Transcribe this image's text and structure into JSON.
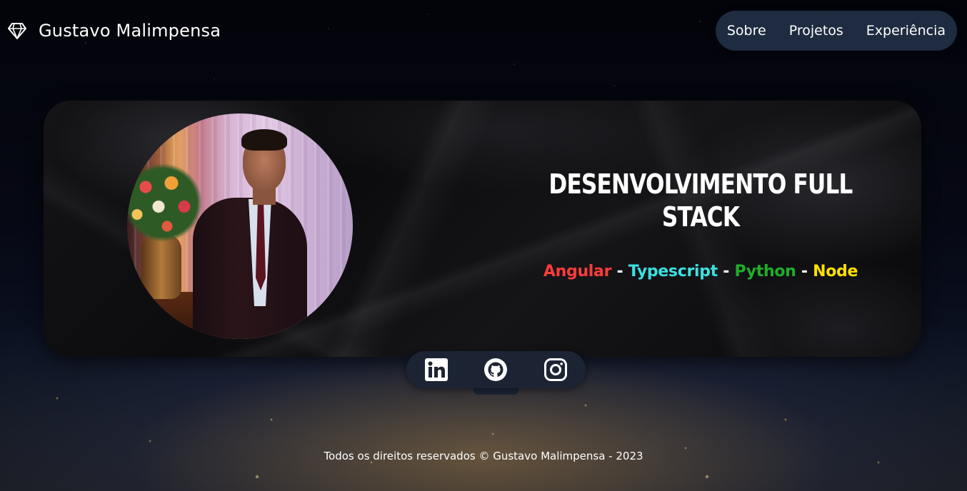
{
  "header": {
    "brand_icon": "diamond-icon",
    "brand_name": "Gustavo Malimpensa"
  },
  "nav": {
    "items": [
      {
        "label": "Sobre"
      },
      {
        "label": "Projetos"
      },
      {
        "label": "Experiência"
      }
    ]
  },
  "hero": {
    "title": "Desenvolvimento Full Stack",
    "technologies": [
      {
        "label": "Angular",
        "color": "#ff3b3b"
      },
      {
        "label": "Typescript",
        "color": "#3de0e0"
      },
      {
        "label": "Python",
        "color": "#1fae2a"
      },
      {
        "label": "Node",
        "color": "#ffe100"
      }
    ],
    "separator": "-",
    "photo": "profile-photo"
  },
  "social": {
    "links": [
      {
        "icon": "linkedin-icon",
        "name": "LinkedIn"
      },
      {
        "icon": "github-icon",
        "name": "GitHub"
      },
      {
        "icon": "instagram-icon",
        "name": "Instagram"
      }
    ]
  },
  "footer": {
    "text": "Todos os direitos reservados © Gustavo Malimpensa - 2023"
  }
}
